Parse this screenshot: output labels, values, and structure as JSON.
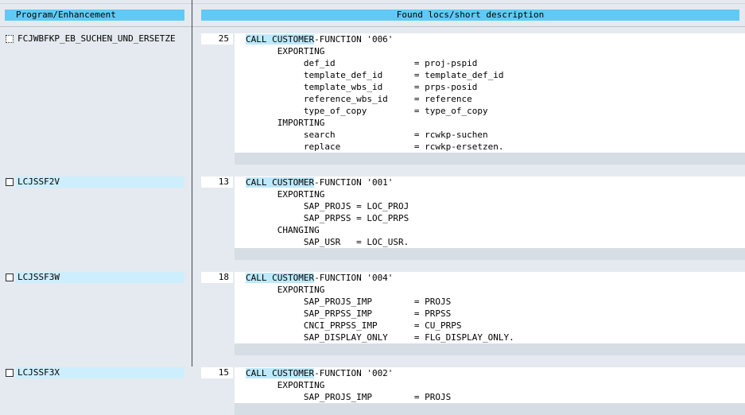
{
  "header": {
    "left_title": "Program/Enhancement",
    "right_title": "Found locs/short description"
  },
  "results": [
    {
      "program": "FCJWBFKP_EB_SUCHEN_UND_ERSETZE",
      "line": "25",
      "lines": [
        [
          "CALL CUSTOMER",
          "-FUNCTION '006'"
        ],
        [
          "",
          "      EXPORTING"
        ],
        [
          "",
          "           def_id               = proj-pspid"
        ],
        [
          "",
          "           template_def_id      = template_def_id"
        ],
        [
          "",
          "           template_wbs_id      = prps-posid"
        ],
        [
          "",
          "           reference_wbs_id     = reference"
        ],
        [
          "",
          "           type_of_copy         = type_of_copy"
        ],
        [
          "",
          "      IMPORTING"
        ],
        [
          "",
          "           search               = rcwkp-suchen"
        ],
        [
          "",
          "           replace              = rcwkp-ersetzen."
        ]
      ]
    },
    {
      "program": "LCJSSF2V",
      "line": "13",
      "lines": [
        [
          "CALL CUSTOMER",
          "-FUNCTION '001'"
        ],
        [
          "",
          "      EXPORTING"
        ],
        [
          "",
          "           SAP_PROJS = LOC_PROJ"
        ],
        [
          "",
          "           SAP_PRPSS = LOC_PRPS"
        ],
        [
          "",
          "      CHANGING"
        ],
        [
          "",
          "           SAP_USR   = LOC_USR."
        ]
      ]
    },
    {
      "program": "LCJSSF3W",
      "line": "18",
      "lines": [
        [
          "CALL CUSTOMER",
          "-FUNCTION '004'"
        ],
        [
          "",
          "      EXPORTING"
        ],
        [
          "",
          "           SAP_PROJS_IMP        = PROJS"
        ],
        [
          "",
          "           SAP_PRPSS_IMP        = PRPSS"
        ],
        [
          "",
          "           CNCI_PRPSS_IMP       = CU_PRPS"
        ],
        [
          "",
          "           SAP_DISPLAY_ONLY     = FLG_DISPLAY_ONLY."
        ]
      ]
    },
    {
      "program": "LCJSSF3X",
      "line": "15",
      "lines": [
        [
          "CALL CUSTOMER",
          "-FUNCTION '002'"
        ],
        [
          "",
          "      EXPORTING"
        ],
        [
          "",
          "           SAP_PROJS_IMP        = PROJS"
        ]
      ]
    }
  ]
}
